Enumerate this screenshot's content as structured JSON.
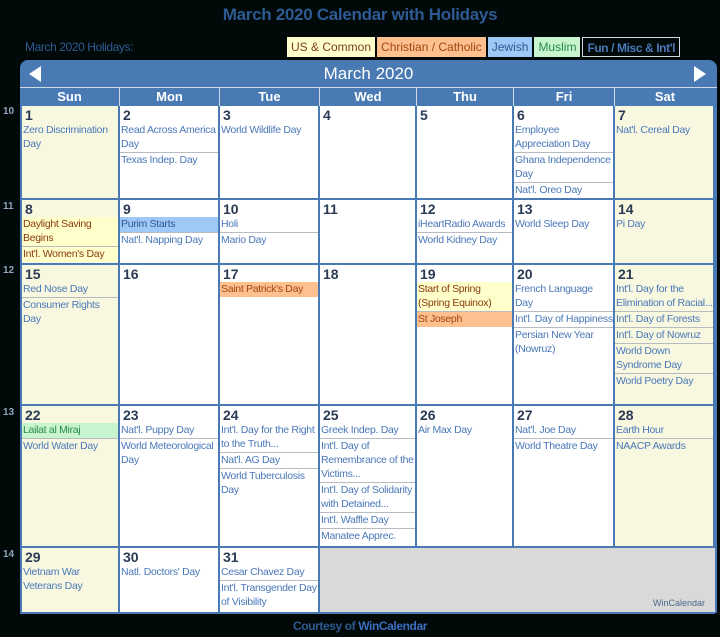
{
  "title": "March 2020 Calendar with Holidays",
  "holidays_label": "March 2020 Holidays:",
  "legend": [
    {
      "label": "US & Common",
      "key": "us",
      "color": "#ffffcc"
    },
    {
      "label": "Christian / Catholic",
      "key": "chr",
      "color": "#ffc090"
    },
    {
      "label": "Jewish",
      "key": "jew",
      "color": "#9ec8f5"
    },
    {
      "label": "Muslim",
      "key": "mus",
      "color": "#c8f5cf"
    },
    {
      "label": "Fun / Misc & Int'l",
      "key": "fun",
      "color": "#010a08"
    }
  ],
  "calendar": {
    "month_title": "March 2020",
    "prev_icon": "chevron-left-icon",
    "next_icon": "chevron-right-icon",
    "days_of_week": [
      "Sun",
      "Mon",
      "Tue",
      "Wed",
      "Thu",
      "Fri",
      "Sat"
    ],
    "weeks": [
      {
        "week_number": "10",
        "days": [
          {
            "day": "1",
            "events": [
              {
                "text": "Zero Discrimination Day",
                "type": "fun"
              }
            ]
          },
          {
            "day": "2",
            "events": [
              {
                "text": "Read Across America Day",
                "type": "fun"
              },
              {
                "text": "Texas Indep. Day",
                "type": "fun"
              }
            ]
          },
          {
            "day": "3",
            "events": [
              {
                "text": "World Wildlife Day",
                "type": "fun"
              }
            ]
          },
          {
            "day": "4",
            "events": []
          },
          {
            "day": "5",
            "events": []
          },
          {
            "day": "6",
            "events": [
              {
                "text": "Employee Appreciation Day",
                "type": "fun"
              },
              {
                "text": "Ghana Independence Day",
                "type": "fun"
              },
              {
                "text": "Nat'l. Oreo Day",
                "type": "fun"
              }
            ]
          },
          {
            "day": "7",
            "events": [
              {
                "text": "Nat'l. Cereal Day",
                "type": "fun"
              }
            ]
          }
        ]
      },
      {
        "week_number": "11",
        "days": [
          {
            "day": "8",
            "events": [
              {
                "text": "Daylight Saving Begins",
                "type": "us"
              },
              {
                "text": "Int'l. Women's Day",
                "type": "us"
              }
            ]
          },
          {
            "day": "9",
            "events": [
              {
                "text": "Purim Starts",
                "type": "jew"
              },
              {
                "text": "Nat'l. Napping Day",
                "type": "fun"
              }
            ]
          },
          {
            "day": "10",
            "events": [
              {
                "text": "Holi",
                "type": "fun"
              },
              {
                "text": "Mario Day",
                "type": "fun"
              }
            ]
          },
          {
            "day": "11",
            "events": []
          },
          {
            "day": "12",
            "events": [
              {
                "text": "iHeartRadio Awards",
                "type": "fun"
              },
              {
                "text": "World Kidney Day",
                "type": "fun"
              }
            ]
          },
          {
            "day": "13",
            "events": [
              {
                "text": "World Sleep Day",
                "type": "fun"
              }
            ]
          },
          {
            "day": "14",
            "events": [
              {
                "text": "Pi Day",
                "type": "fun"
              }
            ]
          }
        ]
      },
      {
        "week_number": "12",
        "days": [
          {
            "day": "15",
            "events": [
              {
                "text": "Red Nose Day",
                "type": "fun"
              },
              {
                "text": "Consumer Rights Day",
                "type": "fun"
              }
            ]
          },
          {
            "day": "16",
            "events": []
          },
          {
            "day": "17",
            "events": [
              {
                "text": "Saint Patrick's Day",
                "type": "chr"
              }
            ]
          },
          {
            "day": "18",
            "events": []
          },
          {
            "day": "19",
            "events": [
              {
                "text": "Start of Spring (Spring Equinox)",
                "type": "us"
              },
              {
                "text": "St Joseph",
                "type": "chr"
              }
            ]
          },
          {
            "day": "20",
            "events": [
              {
                "text": "French Language Day",
                "type": "fun"
              },
              {
                "text": "Int'l. Day of Happiness",
                "type": "fun"
              },
              {
                "text": "Persian New Year (Nowruz)",
                "type": "fun"
              }
            ]
          },
          {
            "day": "21",
            "events": [
              {
                "text": "Int'l. Day for the Elimination of Racial...",
                "type": "fun"
              },
              {
                "text": "Int'l. Day of Forests",
                "type": "fun"
              },
              {
                "text": "Int'l. Day of Nowruz",
                "type": "fun"
              },
              {
                "text": "World Down Syndrome Day",
                "type": "fun"
              },
              {
                "text": "World Poetry Day",
                "type": "fun"
              }
            ]
          }
        ]
      },
      {
        "week_number": "13",
        "days": [
          {
            "day": "22",
            "events": [
              {
                "text": "Lailat al Miraj",
                "type": "mus"
              },
              {
                "text": "World Water Day",
                "type": "fun"
              }
            ]
          },
          {
            "day": "23",
            "events": [
              {
                "text": "Nat'l. Puppy Day",
                "type": "fun"
              },
              {
                "text": "World Meteorological Day",
                "type": "fun"
              }
            ]
          },
          {
            "day": "24",
            "events": [
              {
                "text": "Int'l. Day for the Right to the Truth...",
                "type": "fun"
              },
              {
                "text": "Nat'l. AG Day",
                "type": "fun"
              },
              {
                "text": "World Tuberculosis Day",
                "type": "fun"
              }
            ]
          },
          {
            "day": "25",
            "events": [
              {
                "text": "Greek Indep. Day",
                "type": "fun"
              },
              {
                "text": "Int'l. Day of Remembrance of the Victims...",
                "type": "fun"
              },
              {
                "text": "Int'l. Day of Solidarity with Detained...",
                "type": "fun"
              },
              {
                "text": "Int'l. Waffle Day",
                "type": "fun"
              },
              {
                "text": "Manatee Apprec. Day",
                "type": "fun"
              }
            ]
          },
          {
            "day": "26",
            "events": [
              {
                "text": "Air Max Day",
                "type": "fun"
              }
            ]
          },
          {
            "day": "27",
            "events": [
              {
                "text": "Nat'l. Joe Day",
                "type": "fun"
              },
              {
                "text": "World Theatre Day",
                "type": "fun"
              }
            ]
          },
          {
            "day": "28",
            "events": [
              {
                "text": "Earth Hour",
                "type": "fun"
              },
              {
                "text": "NAACP Awards",
                "type": "fun"
              }
            ]
          }
        ]
      },
      {
        "week_number": "14",
        "days": [
          {
            "day": "29",
            "events": [
              {
                "text": "Vietnam War Veterans Day",
                "type": "fun"
              }
            ]
          },
          {
            "day": "30",
            "events": [
              {
                "text": "Natl. Doctors' Day",
                "type": "fun"
              }
            ]
          },
          {
            "day": "31",
            "events": [
              {
                "text": "Cesar Chavez Day",
                "type": "fun"
              },
              {
                "text": "Int'l. Transgender Day of Visibility",
                "type": "fun"
              }
            ]
          }
        ]
      }
    ],
    "watermark": "WinCalendar"
  },
  "footer": {
    "prefix": "Courtesy of",
    "link": "WinCalendar"
  }
}
